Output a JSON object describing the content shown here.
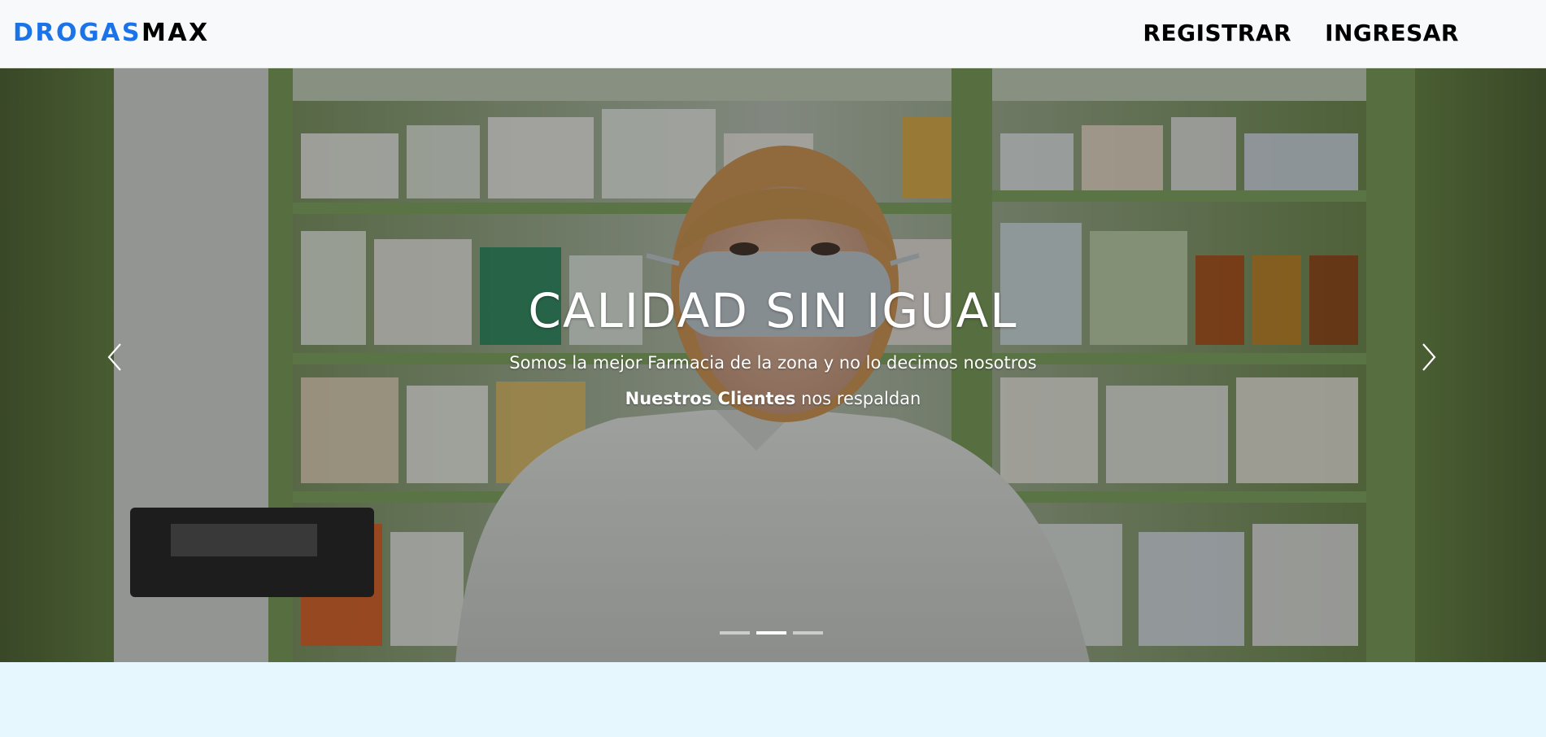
{
  "navbar": {
    "brand_part1": "DROGAS",
    "brand_part2": "MAX",
    "brand_color": "#1a73e8",
    "links": [
      {
        "label": "REGISTRAR"
      },
      {
        "label": "INGRESAR"
      }
    ]
  },
  "carousel": {
    "active_index": 1,
    "slide_count": 3,
    "caption": {
      "title": "CALIDAD SIN IGUAL",
      "line1": "Somos la mejor Farmacia de la zona y no lo decimos nosotros",
      "line2_bold": "Nuestros Clientes",
      "line2_rest": " nos respaldan"
    },
    "controls": {
      "prev_icon": "chevron-left-icon",
      "next_icon": "chevron-right-icon"
    }
  }
}
